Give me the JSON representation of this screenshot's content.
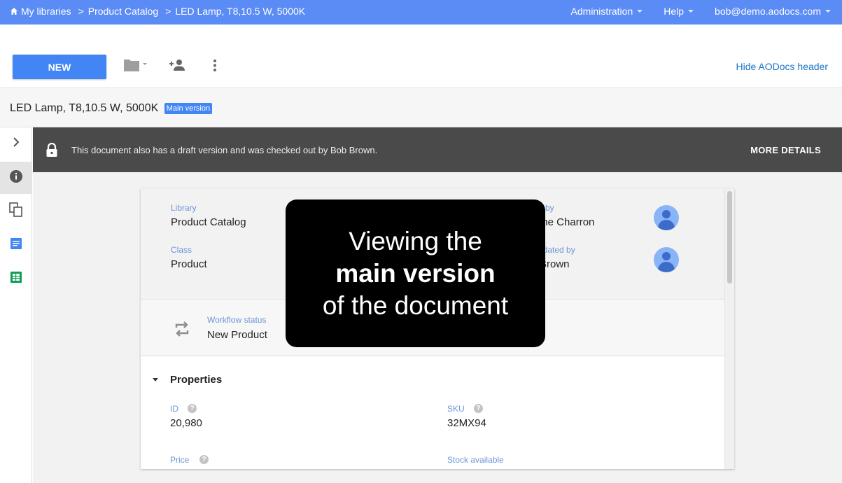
{
  "topbar": {
    "breadcrumbs": [
      "My libraries",
      "Product Catalog",
      "LED Lamp, T8,10.5 W, 5000K"
    ],
    "separator": ">",
    "menus": [
      "Administration",
      "Help",
      "bob@demo.aodocs.com"
    ],
    "home_icon": "home-icon"
  },
  "toolbar": {
    "new_label": "NEW",
    "icons": [
      "folder-icon",
      "add-person-icon",
      "more-vert-icon"
    ],
    "hide_header_label": "Hide AODocs header"
  },
  "document": {
    "title": "LED Lamp, T8,10.5 W, 5000K",
    "version_badge": "Main version"
  },
  "sidebar": {
    "items": [
      "chevron-right-icon",
      "info-icon",
      "copy-icon",
      "doc-icon",
      "sheet-icon"
    ],
    "active": "info-icon"
  },
  "banner": {
    "message": "This document also has a draft version and was checked out by Bob Brown.",
    "action": "MORE DETAILS"
  },
  "card": {
    "library_label": "Library",
    "library_value": "Product Catalog",
    "class_label": "Class",
    "class_value": "Product",
    "created_by_label_partial": "d by",
    "created_by_value_partial": "ine Charron",
    "updated_by_label_partial": "odated by",
    "updated_by_value_partial": "Brown",
    "workflow_label": "Workflow status",
    "workflow_value": "New Product",
    "properties_title": "Properties",
    "properties": {
      "id_label": "ID",
      "id_value": "20,980",
      "sku_label": "SKU",
      "sku_value": "32MX94",
      "price_label": "Price",
      "stock_label": "Stock available"
    }
  },
  "overlay": {
    "line1": "Viewing the",
    "line2": "main version",
    "line3": "of the document"
  },
  "colors": {
    "topbar": "#5b8cf5",
    "accent": "#4285f4",
    "banner": "#4a4a4a",
    "label": "#6b95d6"
  }
}
